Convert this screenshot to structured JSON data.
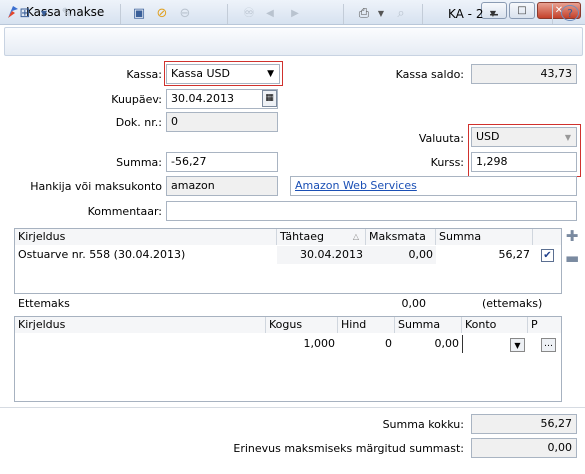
{
  "window": {
    "title": "Kassa makse"
  },
  "toolbar": {
    "doc_name": "KA - 2",
    "icons": [
      "new-doc-icon",
      "dropdown-arrow-icon",
      "edit-icon",
      "save-icon",
      "cancel-icon",
      "delete-icon",
      "binoculars-icon",
      "arrow-left-icon",
      "arrow-right-icon",
      "print-icon",
      "print-preview-icon",
      "help-icon"
    ]
  },
  "form": {
    "kassa_label": "Kassa:",
    "kassa_value": "Kassa USD",
    "kassa_saldo_label": "Kassa saldo:",
    "kassa_saldo_value": "43,73",
    "kuupaev_label": "Kuupäev:",
    "kuupaev_value": "30.04.2013",
    "dok_label": "Dok. nr.:",
    "dok_value": "0",
    "valuuta_label": "Valuuta:",
    "valuuta_value": "USD",
    "summa_label": "Summa:",
    "summa_value": "-56,27",
    "kurss_label": "Kurss:",
    "kurss_value": "1,298",
    "hankija_label": "Hankija või maksukonto",
    "hankija_value": "amazon",
    "hankija_link": "Amazon Web Services",
    "kommentaar_label": "Kommentaar:",
    "kommentaar_value": ""
  },
  "invoice_grid": {
    "headers": [
      "Kirjeldus",
      "Tähtaeg",
      "Maksmata",
      "Summa"
    ],
    "rows": [
      {
        "kirjeldus": "Ostuarve nr. 558 (30.04.2013)",
        "tahtaeg": "30.04.2013",
        "maksmata": "0,00",
        "summa": "56,27",
        "checked": true
      }
    ]
  },
  "ettemaks": {
    "label": "Ettemaks",
    "value": "0,00",
    "suffix": "(ettemaks)"
  },
  "line_grid": {
    "headers": [
      "Kirjeldus",
      "Kogus",
      "Hind",
      "Summa",
      "Konto",
      "P"
    ],
    "rows": [
      {
        "kirjeldus": "",
        "kogus": "1,000",
        "hind": "0",
        "summa": "0,00",
        "konto": ""
      }
    ]
  },
  "totals": {
    "summa_kokku_label": "Summa kokku:",
    "summa_kokku_value": "56,27",
    "erinevus_label": "Erinevus maksmiseks märgitud summast:",
    "erinevus_value": "0,00"
  }
}
